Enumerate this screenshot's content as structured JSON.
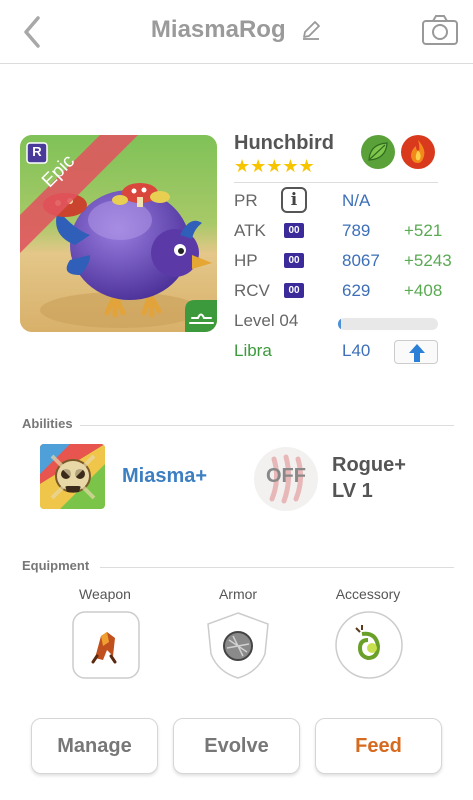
{
  "header": {
    "title": "MiasmaRog"
  },
  "monster": {
    "name": "Hunchbird",
    "stars": "★★★★★",
    "rarity": "Epic",
    "grade_letter": "R",
    "elements": [
      "leaf",
      "fire"
    ]
  },
  "stats": {
    "pr": {
      "label": "PR",
      "value": "N/A",
      "info_glyph": "i"
    },
    "atk": {
      "label": "ATK",
      "badge": "00",
      "value": "789",
      "bonus": "+521"
    },
    "hp": {
      "label": "HP",
      "badge": "00",
      "value": "8067",
      "bonus": "+5243"
    },
    "rcv": {
      "label": "RCV",
      "badge": "00",
      "value": "629",
      "bonus": "+408"
    },
    "level": {
      "label": "Level 04",
      "progress": 0.03
    },
    "sign": {
      "label": "Libra",
      "value": "L40"
    }
  },
  "abilities": {
    "section_label": "Abilities",
    "primary": {
      "name": "Miasma+"
    },
    "secondary": {
      "status": "OFF",
      "name": "Rogue+",
      "level": "LV 1"
    }
  },
  "equipment": {
    "section_label": "Equipment",
    "slots": [
      {
        "label": "Weapon"
      },
      {
        "label": "Armor"
      },
      {
        "label": "Accessory"
      }
    ]
  },
  "actions": {
    "manage": "Manage",
    "evolve": "Evolve",
    "feed": "Feed"
  },
  "colors": {
    "accent_blue": "#3d6fb8",
    "bonus_green": "#5aaa52",
    "feed_orange": "#d66a1f",
    "epic_ribbon": "#e0545e",
    "stat_badge": "#3b2a9a"
  },
  "icons": {
    "back": "chevron-left-icon",
    "edit": "pencil-icon",
    "camera": "camera-icon",
    "up": "arrow-up-icon"
  }
}
